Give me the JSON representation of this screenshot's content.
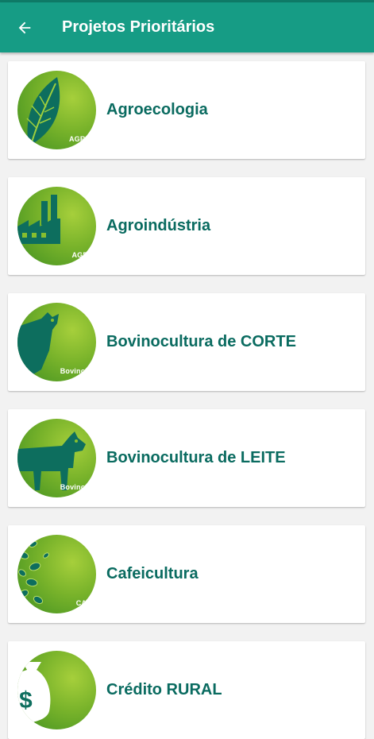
{
  "app_bar": {
    "title": "Projetos Prioritários",
    "back_icon": "arrow-left-icon"
  },
  "colors": {
    "primary": "#169c85",
    "card_text": "#0a6b60",
    "icon_green": "#77b22a"
  },
  "projects": [
    {
      "label": "Agroecologia",
      "icon": "leaf-icon",
      "caption": "AGROE"
    },
    {
      "label": "Agroindústria",
      "icon": "factory-icon",
      "caption": "AGROI"
    },
    {
      "label": "Bovinocultura de CORTE",
      "icon": "bull-icon",
      "caption": "Bovinocul"
    },
    {
      "label": "Bovinocultura de LEITE",
      "icon": "cow-icon",
      "caption": "Bovinocul"
    },
    {
      "label": "Cafeicultura",
      "icon": "coffee-beans-icon",
      "caption": "CAFE"
    },
    {
      "label": "Crédito RURAL",
      "icon": "money-bag-icon",
      "caption": ""
    }
  ]
}
